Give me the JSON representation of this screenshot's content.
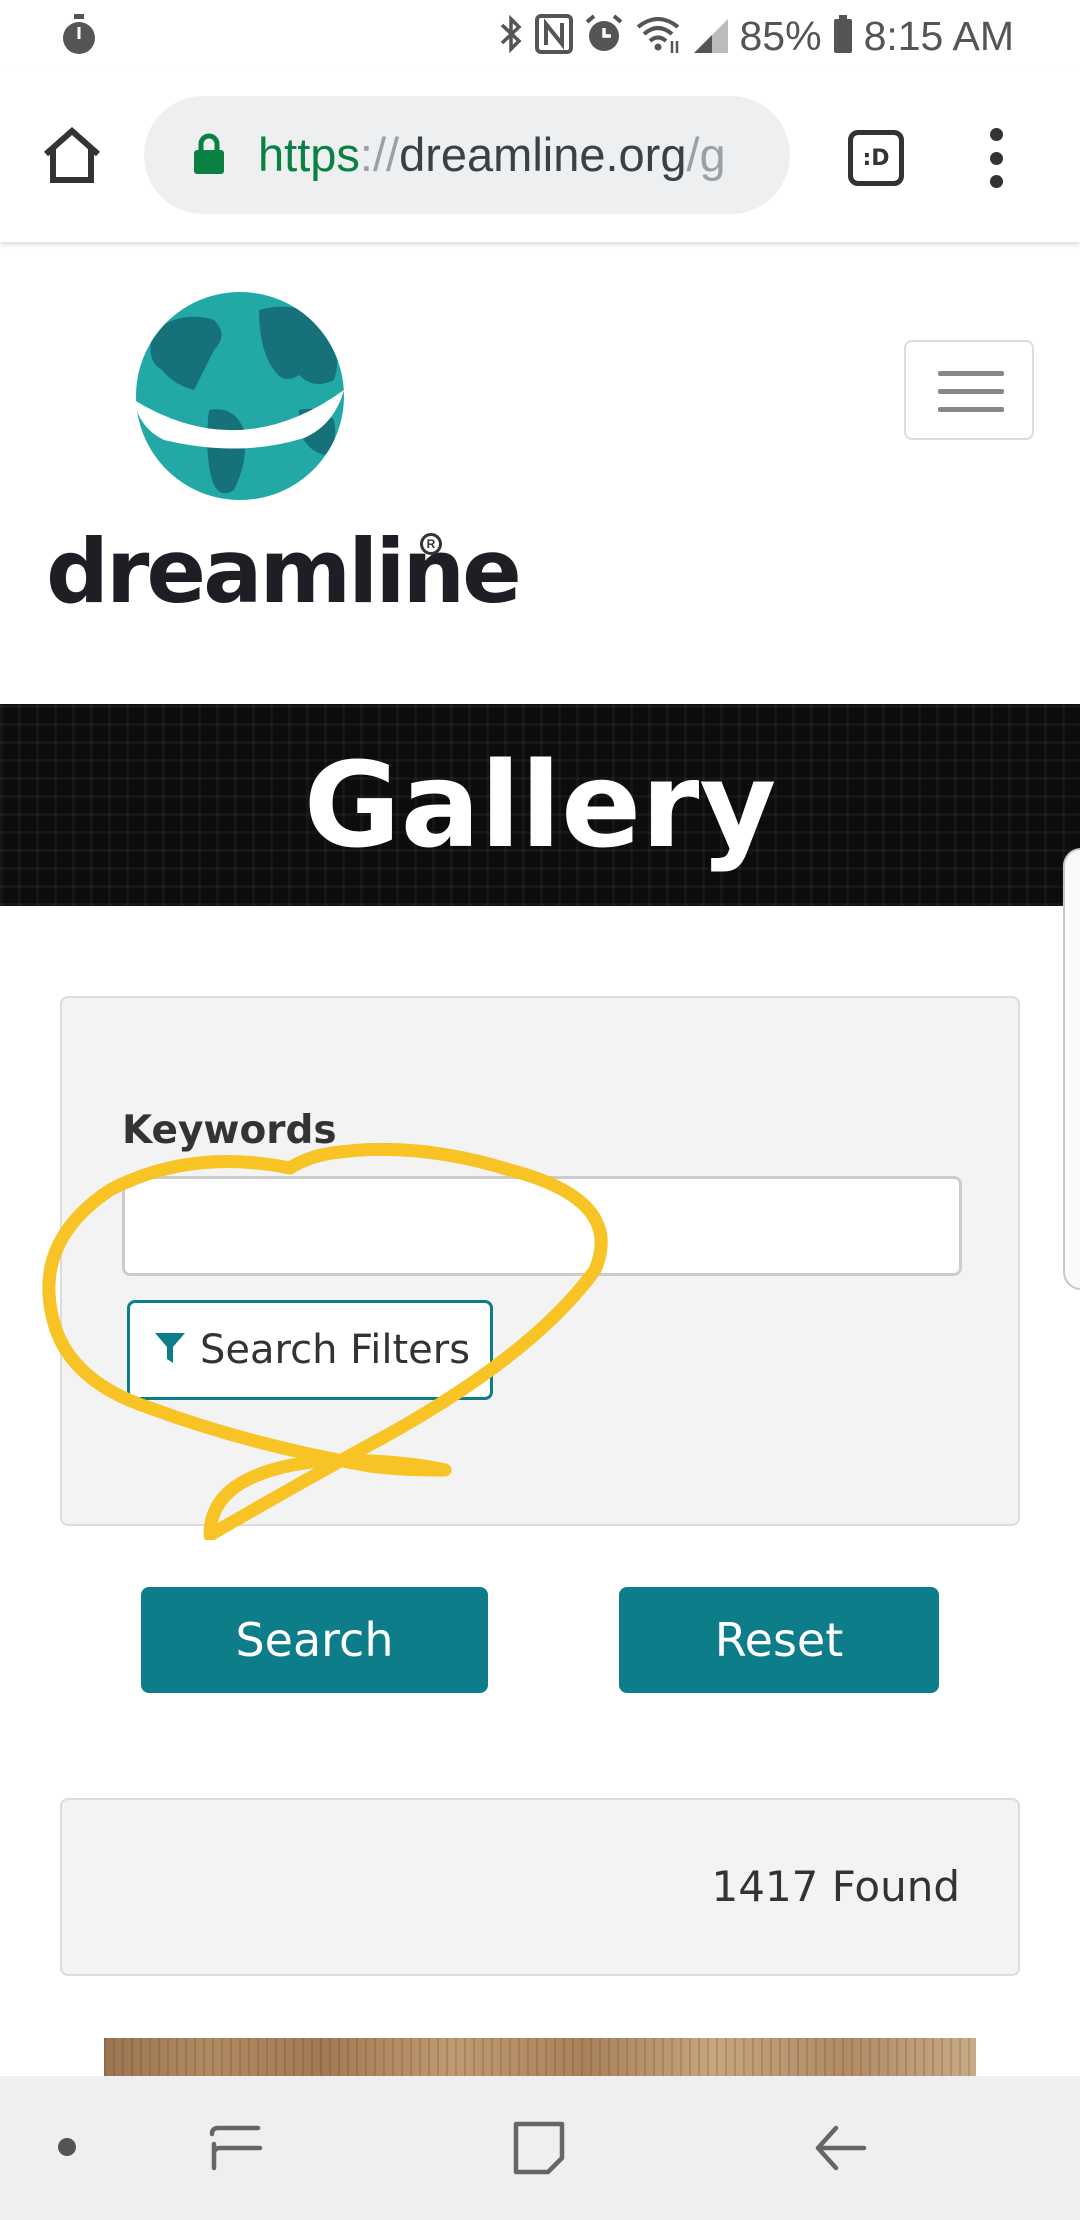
{
  "status_bar": {
    "battery": "85%",
    "time": "8:15 AM",
    "icons": [
      "stopwatch-icon",
      "bluetooth-icon",
      "nfc-icon",
      "alarm-icon",
      "wifi-icon",
      "signal-icon",
      "battery-icon"
    ]
  },
  "browser": {
    "url_scheme": "https",
    "url_separator": "://",
    "url_host": "dreamline.org",
    "url_path": "/g",
    "tabs_label": ":D",
    "icons": [
      "home-icon",
      "lock-icon",
      "overflow-menu-icon"
    ]
  },
  "site": {
    "logo_text": "dreamline",
    "logo_registered": "R"
  },
  "banner": {
    "title": "Gallery"
  },
  "search": {
    "keywords_label": "Keywords",
    "keywords_value": "",
    "filters_label": "Search Filters",
    "search_button": "Search",
    "reset_button": "Reset"
  },
  "results": {
    "count_text": "1417 Found"
  },
  "colors": {
    "accent": "#0e7d8a",
    "annotation": "#f7c325",
    "banner_bg": "#0c0c0c",
    "url_scheme": "#0b8043"
  }
}
